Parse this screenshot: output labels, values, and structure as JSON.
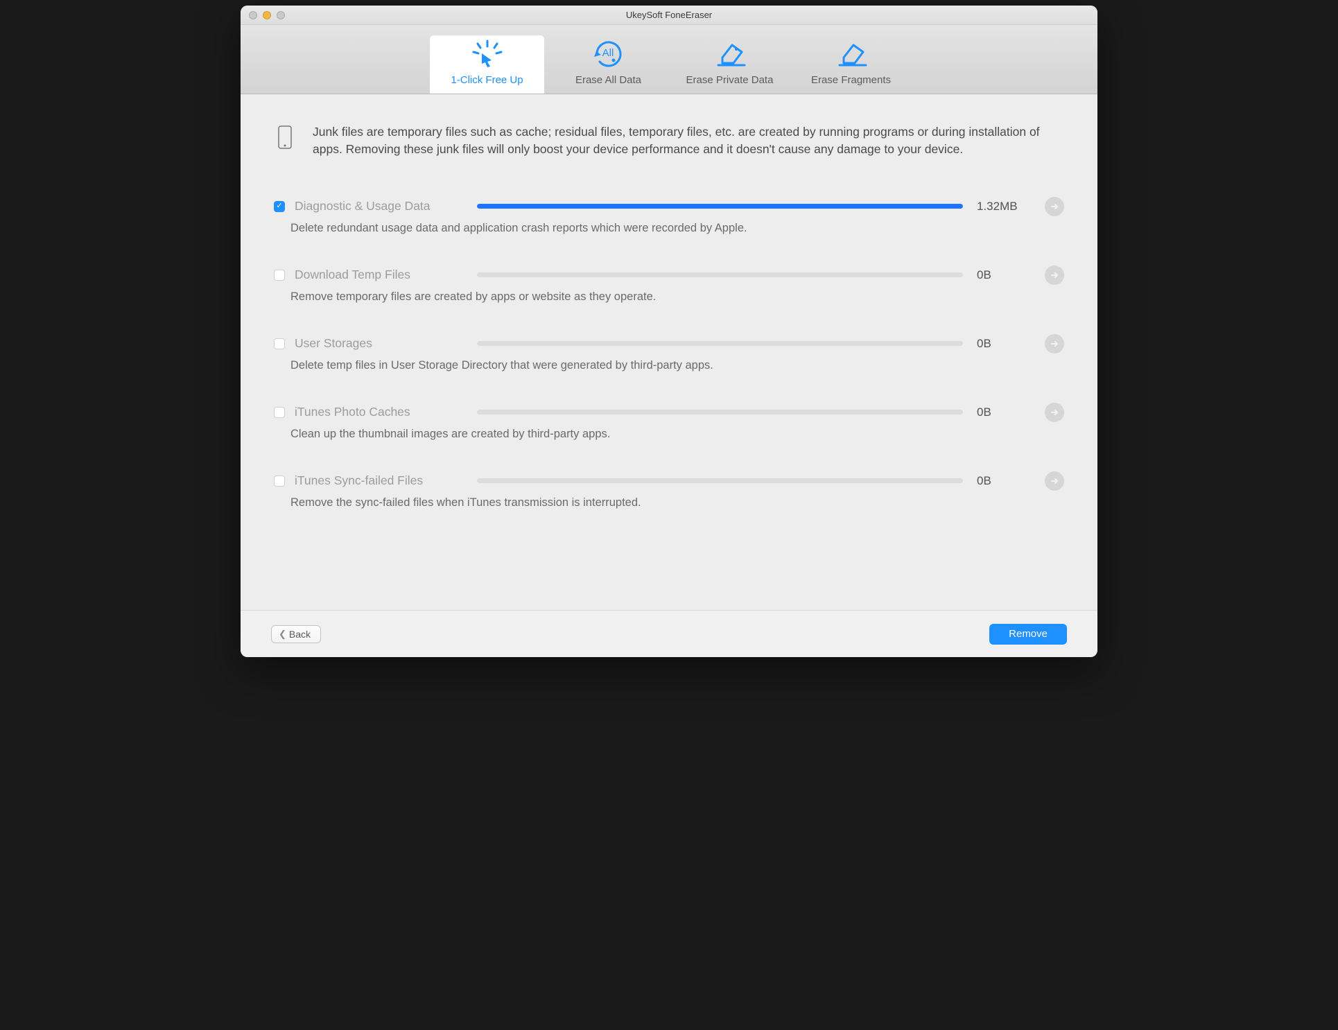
{
  "window": {
    "title": "UkeySoft FoneEraser"
  },
  "tabs": [
    {
      "label": "1-Click Free Up",
      "active": true
    },
    {
      "label": "Erase All Data",
      "active": false
    },
    {
      "label": "Erase Private Data",
      "active": false
    },
    {
      "label": "Erase Fragments",
      "active": false
    }
  ],
  "intro": "Junk files are temporary files such as cache; residual files, temporary files, etc. are created by running programs or during installation of apps. Removing these junk files will only boost your device performance and it doesn't cause any damage to your device.",
  "items": [
    {
      "title": "Diagnostic & Usage Data",
      "desc": "Delete redundant usage data and application crash reports which were recorded by Apple.",
      "size": "1.32MB",
      "checked": true,
      "progress_pct": 100,
      "fill_color": "#1e74ff"
    },
    {
      "title": "Download Temp Files",
      "desc": "Remove temporary files are created by apps or website as they operate.",
      "size": "0B",
      "checked": false,
      "progress_pct": 0,
      "fill_color": "#1e74ff"
    },
    {
      "title": "User Storages",
      "desc": "Delete temp files in User Storage Directory that were generated by third-party apps.",
      "size": "0B",
      "checked": false,
      "progress_pct": 0,
      "fill_color": "#1e74ff"
    },
    {
      "title": "iTunes Photo Caches",
      "desc": "Clean up the thumbnail images are created by third-party apps.",
      "size": "0B",
      "checked": false,
      "progress_pct": 0,
      "fill_color": "#1e74ff"
    },
    {
      "title": "iTunes Sync-failed Files",
      "desc": "Remove the sync-failed files when iTunes transmission is interrupted.",
      "size": "0B",
      "checked": false,
      "progress_pct": 0,
      "fill_color": "#1e74ff"
    }
  ],
  "footer": {
    "back": "Back",
    "remove": "Remove"
  },
  "colors": {
    "accent": "#1e90ff"
  }
}
